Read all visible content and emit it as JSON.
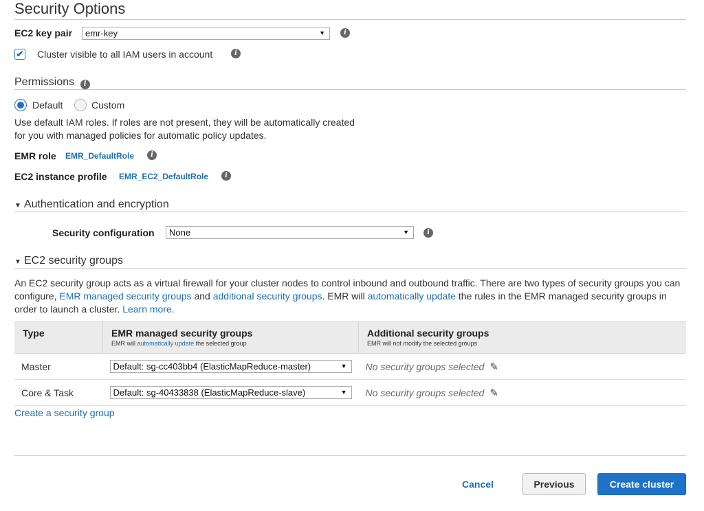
{
  "page_title": "Security Options",
  "key_pair": {
    "label": "EC2 key pair",
    "value": "emr-key"
  },
  "visible_all": {
    "label": "Cluster visible to all IAM users in account",
    "checked": true
  },
  "permissions": {
    "title": "Permissions",
    "options": [
      "Default",
      "Custom"
    ],
    "selected": "Default",
    "description_line1": "Use default IAM roles. If roles are not present, they will be automatically created",
    "description_line2": "for you with managed policies for automatic policy updates.",
    "emr_role_label": "EMR role",
    "emr_role_value": "EMR_DefaultRole",
    "profile_label": "EC2 instance profile",
    "profile_value": "EMR_EC2_DefaultRole"
  },
  "auth": {
    "title": "Authentication and encryption",
    "security_config_label": "Security configuration",
    "security_config_value": "None"
  },
  "sg": {
    "title": "EC2 security groups",
    "desc_part1": "An EC2 security group acts as a virtual firewall for your cluster nodes to control inbound and outbound traffic. There are two types of security groups you can configure, ",
    "link_managed": "EMR managed security groups",
    "desc_and": " and ",
    "link_additional": "additional security groups",
    "desc_part2": ". EMR will ",
    "link_auto": "automatically update",
    "desc_part3": " the rules in the EMR managed security groups in order to launch a cluster. ",
    "link_learn": "Learn more.",
    "col_type": "Type",
    "col_managed": "EMR managed security groups",
    "col_managed_sub_pre": "EMR will ",
    "col_managed_sub_link": "automatically update",
    "col_managed_sub_post": " the selected group",
    "col_additional": "Additional security groups",
    "col_additional_sub": "EMR will not modify the selected groups",
    "rows": [
      {
        "type": "Master",
        "managed": "Default: sg-cc403bb4 (ElasticMapReduce-master)",
        "additional": "No security groups selected"
      },
      {
        "type": "Core & Task",
        "managed": "Default: sg-40433838 (ElasticMapReduce-slave)",
        "additional": "No security groups selected"
      }
    ],
    "create_link": "Create a security group"
  },
  "footer": {
    "cancel": "Cancel",
    "previous": "Previous",
    "create": "Create cluster"
  },
  "icons": {
    "info": "info-icon",
    "pencil": "pencil-icon",
    "caret": "caret-down-icon",
    "check": "checkmark-icon"
  },
  "colors": {
    "link": "#1a6eb5",
    "primary_button": "#1e72c8"
  }
}
